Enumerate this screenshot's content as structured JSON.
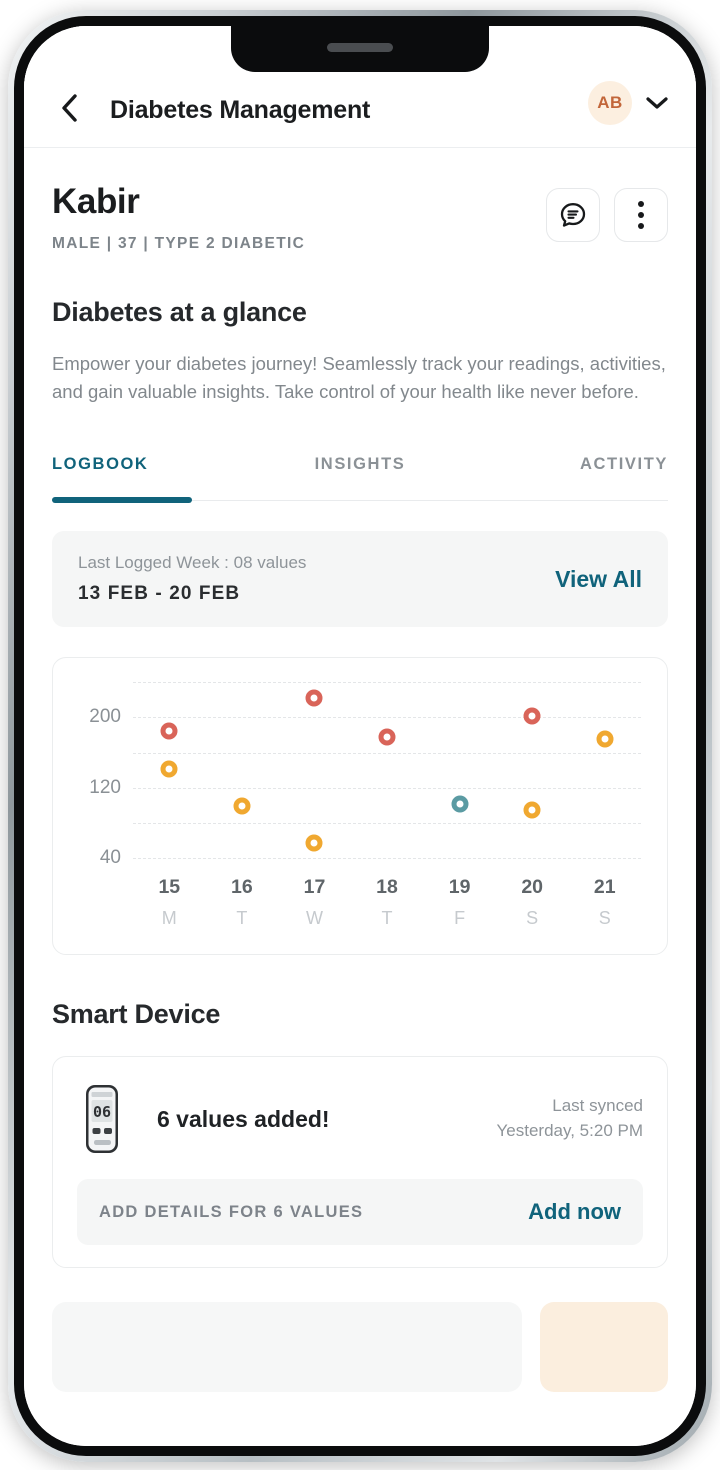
{
  "appbar": {
    "back_icon": "chevron-left-icon",
    "title": "Diabetes Management",
    "avatar_initials": "AB",
    "avatar_bg": "#fcefe0",
    "avatar_fg": "#c2663a",
    "dropdown_icon": "chevron-down-icon"
  },
  "patient": {
    "name": "Kabir",
    "meta": "MALE | 37 | TYPE 2 DIABETIC",
    "chat_icon": "chat-bubble-icon",
    "more_icon": "more-vertical-icon"
  },
  "overview": {
    "title": "Diabetes at a glance",
    "description": "Empower your diabetes journey! Seamlessly track your readings, activities, and gain valuable insights. Take control of your health like never before."
  },
  "tabs": [
    {
      "label": "LOGBOOK",
      "active": true
    },
    {
      "label": "INSIGHTS",
      "active": false
    },
    {
      "label": "ACTIVITY",
      "active": false
    }
  ],
  "week_summary": {
    "label": "Last Logged Week : 08 values",
    "range": "13 FEB - 20 FEB",
    "view_all_label": "View All",
    "accent": "#10637b"
  },
  "chart_data": {
    "type": "scatter",
    "title": "",
    "xlabel": "",
    "ylabel": "",
    "ylim": [
      20,
      240
    ],
    "yticks": [
      40,
      120,
      200
    ],
    "ytick_labels": [
      "40",
      "120",
      "200"
    ],
    "gridlines": [
      40,
      80,
      120,
      160,
      200,
      240
    ],
    "grid": true,
    "legend": "none",
    "categories": [
      "15",
      "16",
      "17",
      "18",
      "19",
      "20",
      "21"
    ],
    "weekday_labels": [
      "M",
      "T",
      "W",
      "T",
      "F",
      "S",
      "S"
    ],
    "colors": {
      "high": "#d96459",
      "normal": "#f0a830",
      "low": "#5b9ba3"
    },
    "points": [
      {
        "x": "15",
        "x_index": 0,
        "value": 185,
        "color": "#d96459"
      },
      {
        "x": "15",
        "x_index": 0,
        "value": 142,
        "color": "#f0a830"
      },
      {
        "x": "16",
        "x_index": 1,
        "value": 100,
        "color": "#f0a830"
      },
      {
        "x": "17",
        "x_index": 2,
        "value": 222,
        "color": "#d96459"
      },
      {
        "x": "17",
        "x_index": 2,
        "value": 58,
        "color": "#f0a830"
      },
      {
        "x": "18",
        "x_index": 3,
        "value": 178,
        "color": "#d96459"
      },
      {
        "x": "19",
        "x_index": 4,
        "value": 102,
        "color": "#5b9ba3"
      },
      {
        "x": "20",
        "x_index": 5,
        "value": 201,
        "color": "#d96459"
      },
      {
        "x": "20",
        "x_index": 5,
        "value": 95,
        "color": "#f0a830"
      },
      {
        "x": "21",
        "x_index": 6,
        "value": 175,
        "color": "#f0a830"
      }
    ]
  },
  "smart_device": {
    "heading": "Smart Device",
    "device_icon": "glucometer-icon",
    "device_display": "06",
    "message": "6 values added!",
    "sync_line1": "Last synced",
    "sync_line2": "Yesterday, 5:20 PM",
    "cta_label": "ADD DETAILS FOR 6 VALUES",
    "cta_action": "Add now"
  }
}
